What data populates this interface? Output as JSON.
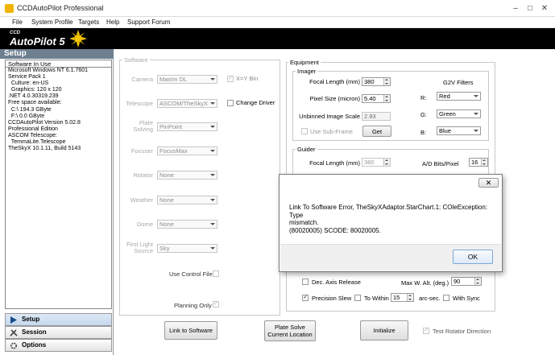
{
  "window": {
    "title": "CCDAutoPilot  Professional"
  },
  "menu": [
    "File",
    "System Profile",
    "Targets",
    "Help",
    "Support Forum"
  ],
  "brand": {
    "small": "CCD",
    "big": "AutoPilot 5"
  },
  "sidebar": {
    "header": "Setup",
    "software_header": "Software In Use",
    "software_info": [
      "Microsoft Windows NT 6.1.7601",
      "Service Pack 1",
      "  Culture: en-US",
      "  Graphics: 120 x 120",
      ".NET 4.0.30319.239",
      "Free space available:",
      "  C:\\ 194.3 GByte",
      "  F:\\ 0.0 GByte",
      "CCDAutoPilot Version 5.02.8",
      "Professional Edition",
      "ASCOM Telescope:",
      "  TemmaLite.Telescope",
      "TheSkyX 10.1.11, Build 5143"
    ],
    "nav": [
      {
        "label": "Setup"
      },
      {
        "label": "Session"
      },
      {
        "label": "Options"
      }
    ]
  },
  "software": {
    "group_label": "Software",
    "camera_label": "Camera",
    "camera_value": "MaxIm DL",
    "xybin_label": "X=Y Bin",
    "telescope_label": "Telescope",
    "telescope_value": "ASCOM/TheSkyX",
    "change_driver_label": "Change Driver",
    "plate_label_1": "Plate",
    "plate_label_2": "Solving",
    "plate_value": "PinPoint",
    "focuser_label": "Focuser",
    "focuser_value": "FocusMax",
    "rotator_label": "Rotator",
    "rotator_value": "None",
    "weather_label": "Weather",
    "weather_value": "None",
    "dome_label": "Dome",
    "dome_value": "None",
    "firstlight_label_1": "First Light",
    "firstlight_label_2": "Source",
    "firstlight_value": "Sky",
    "use_control_file_label": "Use Control File",
    "planning_only_label": "Planning Only"
  },
  "equipment": {
    "group_label": "Equipment",
    "imager": {
      "group_label": "Imager",
      "focal_length_label": "Focal Length (mm)",
      "focal_length_value": "380",
      "pixel_size_label": "Pixel Size (micron)",
      "pixel_size_value": "5.40",
      "unbinned_scale_label": "Unbinned Image Scale",
      "unbinned_scale_value": "2.93",
      "use_subframe_label": "Use Sub-Frame",
      "get_button": "Get",
      "g2v_label": "G2V Filters",
      "r_label": "R:",
      "r_value": "Red",
      "g_label": "G:",
      "g_value": "Green",
      "b_label": "B:",
      "b_value": "Blue"
    },
    "guider": {
      "group_label": "Guider",
      "focal_length_label": "Focal Length (mm)",
      "focal_length_value": "380",
      "ad_bits_label": "A/D Bits/Pixel",
      "ad_bits_value": "16"
    },
    "dec_axis_release_label": "Dec. Axis Release",
    "max_w_alt_label": "Max W. Alt. (deg.)",
    "max_w_alt_value": "90",
    "precision_slew_label": "Precision Slew",
    "to_within_label": "To Within",
    "to_within_value": "15",
    "arcsec_label": "arc-sec.",
    "with_sync_label": "With Sync"
  },
  "buttons": {
    "link_to_software": "Link to Software",
    "plate_solve_1": "Plate Solve",
    "plate_solve_2": "Current Location",
    "initialize": "Initialize",
    "test_rotator_label": "Test Rotator Direction"
  },
  "dialog": {
    "close_glyph": "✕",
    "message_line1": "Link To Software Error, TheSkyXAdaptor.StarChart.1: COleException: Type",
    "message_line2": "mismatch.",
    "message_line3": "(80020005) SCODE: 80020005.",
    "ok_label": "OK"
  },
  "colors": {
    "setup_header_bg": "#6e7f8f",
    "brand_bg": "#000000",
    "disabled_text": "#a8a8a8"
  }
}
